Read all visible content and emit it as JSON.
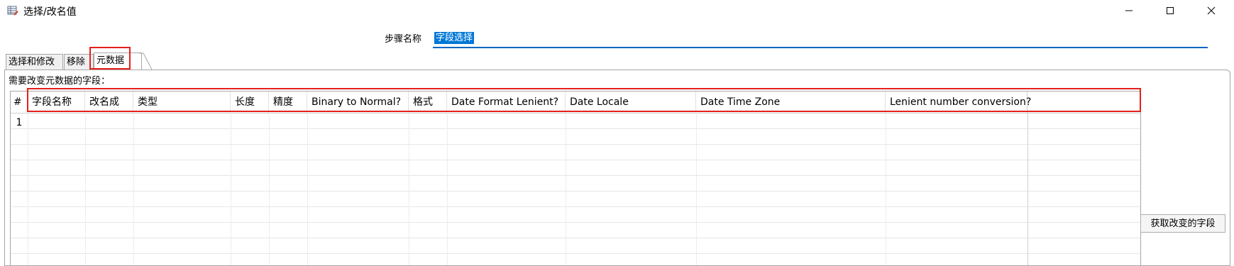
{
  "window": {
    "title": "选择/改名值",
    "icon": "table-edit-icon"
  },
  "step": {
    "label": "步骤名称",
    "value": "字段选择"
  },
  "tabs": [
    {
      "label": "选择和修改"
    },
    {
      "label": "移除"
    },
    {
      "label": "元数据",
      "active": true
    }
  ],
  "metadata": {
    "label": "需要改变元数据的字段：",
    "columns": [
      "#",
      "字段名称",
      "改名成",
      "类型",
      "长度",
      "精度",
      "Binary to Normal?",
      "格式",
      "Date Format Lenient?",
      "Date Locale",
      "Date Time Zone",
      "Lenient number conversion?"
    ],
    "rows": [
      [
        "1",
        "",
        "",
        "",
        "",
        "",
        "",
        "",
        "",
        "",
        "",
        ""
      ]
    ]
  },
  "buttons": {
    "get_changed_fields": "获取改变的字段"
  },
  "colors": {
    "accent": "#0078d7",
    "highlight": "#e5201b"
  }
}
